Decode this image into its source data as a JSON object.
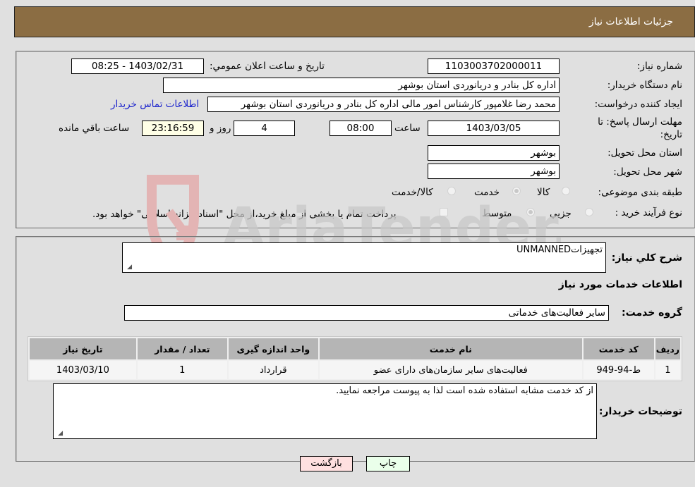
{
  "header": {
    "title": "جزئیات اطلاعات نیاز"
  },
  "form": {
    "need_number": {
      "label": "شماره نیاز:",
      "value": "1103003702000011"
    },
    "announce_datetime": {
      "label": "تاریخ و ساعت اعلان عمومي:",
      "value": "1403/02/31 - 08:25"
    },
    "buyer_org": {
      "label": "نام دستگاه خريدار:",
      "value": "اداره کل بنادر و دریانوردی استان بوشهر"
    },
    "requester": {
      "label": "ايجاد کننده درخواست:",
      "value": "محمد رضا غلامپور کارشناس امور مالی اداره کل بنادر و دریانوردی استان بوشهر"
    },
    "buyer_contact_link": "اطلاعات تماس خريدار",
    "deadline": {
      "label": "مهلت ارسال پاسخ: تا تاريخ:",
      "date": "1403/03/05",
      "time_label": "ساعت",
      "time": "08:00",
      "days": "4",
      "days_label": "روز و",
      "remaining": "23:16:59",
      "remaining_label": "ساعت باقي مانده"
    },
    "delivery_province": {
      "label": "استان محل تحويل:",
      "value": "بوشهر"
    },
    "delivery_city": {
      "label": "شهر محل تحويل:",
      "value": "بوشهر"
    },
    "category": {
      "label": "طبقه بندی موضوعی:",
      "options": [
        "کالا",
        "خدمت",
        "کالا/خدمت"
      ],
      "selected": "خدمت"
    },
    "purchase_type": {
      "label": "نوع فرآيند خريد :",
      "options": [
        "جزيي",
        "متوسط"
      ],
      "selected": "متوسط",
      "treasury_note": "پرداخت تمام يا بخشی از مبلغ خريد،از محل \"اسناد خزانه اسلامی\" خواهد بود."
    }
  },
  "details": {
    "description_label": "شرح کلي نياز:",
    "description_value": "تجهيزاتUNMANNED",
    "services_heading": "اطلاعات خدمات مورد نياز",
    "service_group_label": "گروه خدمت:",
    "service_group_value": "ساير فعاليت‌های خدماتی",
    "table": {
      "headers": [
        "رديف",
        "کد خدمت",
        "نام خدمت",
        "واحد اندازه گيری",
        "تعداد / مقدار",
        "تاريخ نياز"
      ],
      "rows": [
        [
          "1",
          "ط-94-949",
          "فعاليت‌های ساير سازمان‌های دارای عضو",
          "قرارداد",
          "1",
          "1403/03/10"
        ]
      ]
    },
    "buyer_notes_label": "توضيحات خريدار:",
    "buyer_notes_value": "از کد خدمت مشابه استفاده شده است لذا به پيوست مراجعه نماييد."
  },
  "buttons": {
    "print": "چاپ",
    "back": "بازگشت"
  },
  "watermark": {
    "text": "AriaTender.neT"
  },
  "colors": {
    "header_bg": "#8b6d43",
    "print_bg": "#eaffea",
    "back_bg": "#ffe0e0",
    "remaining_bg": "#ffffe6",
    "link": "#1a22cc"
  }
}
